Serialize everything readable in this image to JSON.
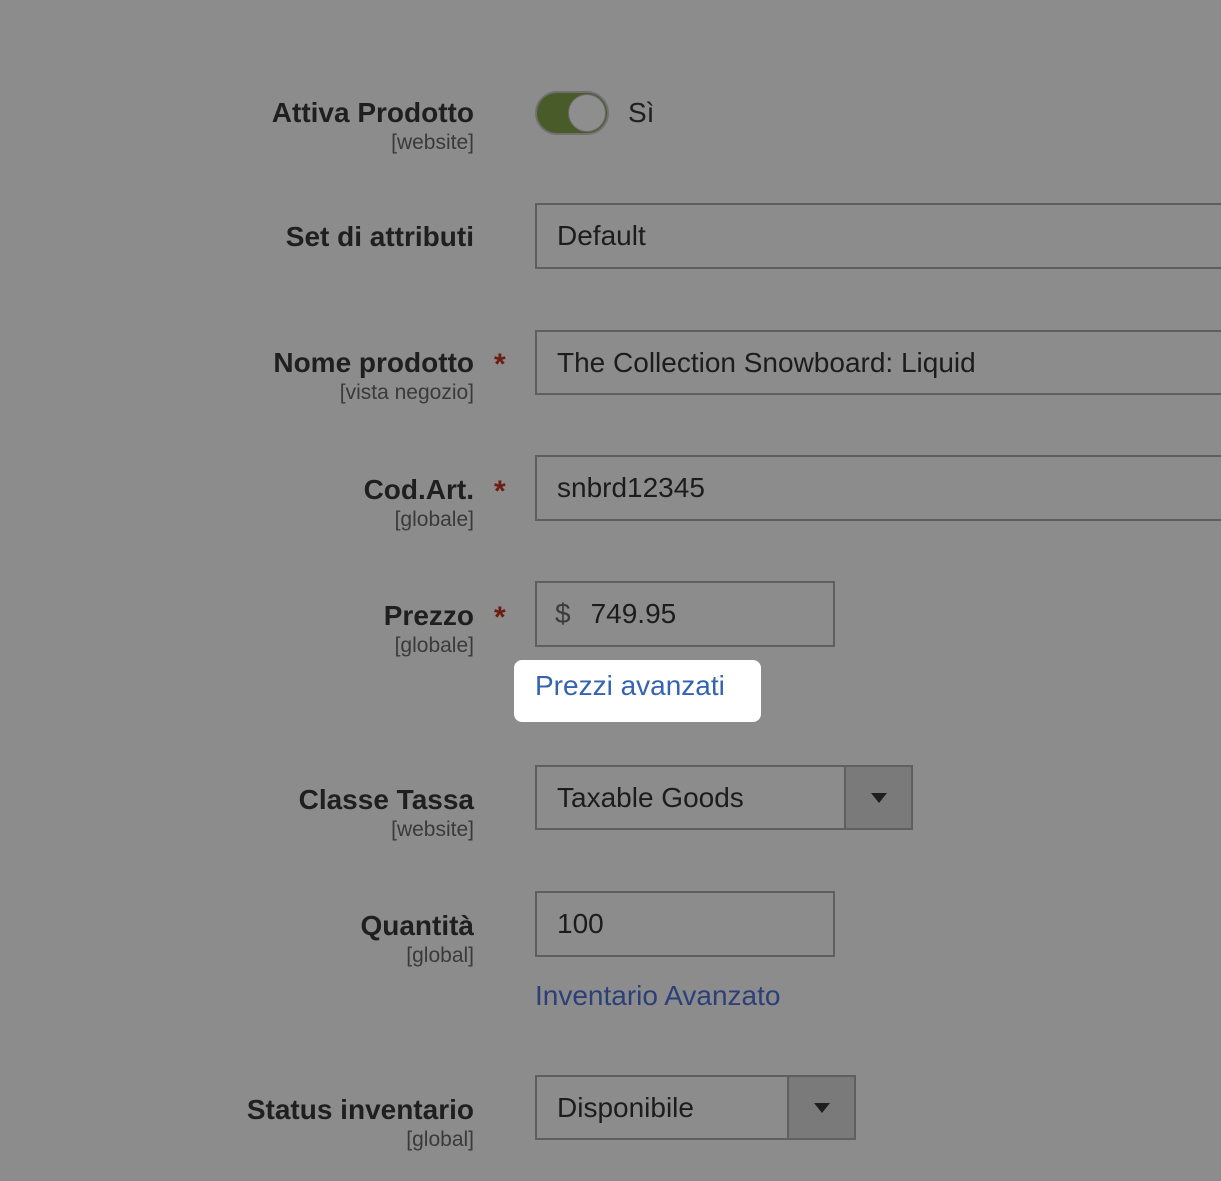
{
  "fields": {
    "active": {
      "label": "Attiva Prodotto",
      "scope": "[website]",
      "value_label": "Sì",
      "enabled": true
    },
    "attribute_set": {
      "label": "Set di attributi",
      "value": "Default"
    },
    "product_name": {
      "label": "Nome prodotto",
      "scope": "[vista negozio]",
      "required_mark": "*",
      "value": "The Collection Snowboard: Liquid"
    },
    "sku": {
      "label": "Cod.Art.",
      "scope": "[globale]",
      "required_mark": "*",
      "value": "snbrd12345"
    },
    "price": {
      "label": "Prezzo",
      "scope": "[globale]",
      "required_mark": "*",
      "currency": "$",
      "value": "749.95",
      "advanced_link": "Prezzi avanzati"
    },
    "tax_class": {
      "label": "Classe Tassa",
      "scope": "[website]",
      "value": "Taxable Goods"
    },
    "quantity": {
      "label": "Quantità",
      "scope": "[global]",
      "value": "100",
      "advanced_link": "Inventario Avanzato"
    },
    "stock_status": {
      "label": "Status inventario",
      "scope": "[global]",
      "value": "Disponibile"
    }
  },
  "colors": {
    "overlay_background": "#8c8c8c",
    "toggle_on": "#4a5b2a",
    "link": "#2c3f79",
    "highlighted_link": "#3563b0",
    "required": "#6b1d10"
  },
  "icons": {
    "select_arrow": "triangle-down-icon"
  }
}
